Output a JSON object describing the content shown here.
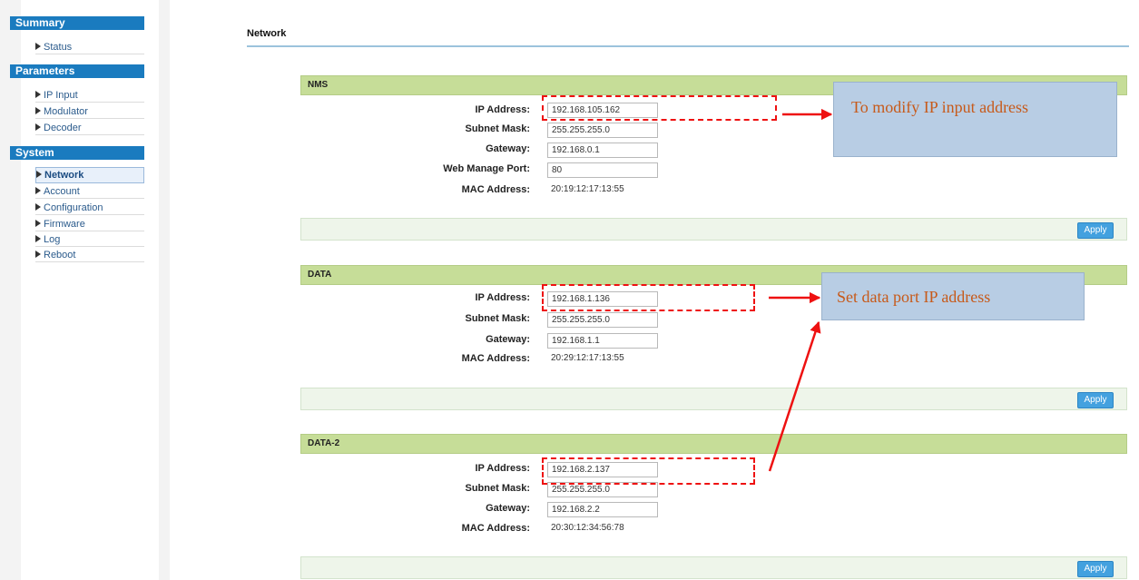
{
  "sidebar": {
    "sections": [
      {
        "title": "Summary",
        "items": [
          "Status"
        ]
      },
      {
        "title": "Parameters",
        "items": [
          "IP Input",
          "Modulator",
          "Decoder"
        ]
      },
      {
        "title": "System",
        "items": [
          "Network",
          "Account",
          "Configuration",
          "Firmware",
          "Log",
          "Reboot"
        ]
      }
    ],
    "active_item": "Network"
  },
  "page": {
    "title": "Network"
  },
  "panels": {
    "nms": {
      "title": "NMS",
      "ip_label": "IP Address:",
      "ip_value": "192.168.105.162",
      "subnet_label": "Subnet Mask:",
      "subnet_value": "255.255.255.0",
      "gateway_label": "Gateway:",
      "gateway_value": "192.168.0.1",
      "port_label": "Web Manage Port:",
      "port_value": "80",
      "mac_label": "MAC Address:",
      "mac_value": "20:19:12:17:13:55",
      "apply_label": "Apply"
    },
    "data": {
      "title": "DATA",
      "ip_label": "IP Address:",
      "ip_value": "192.168.1.136",
      "subnet_label": "Subnet Mask:",
      "subnet_value": "255.255.255.0",
      "gateway_label": "Gateway:",
      "gateway_value": "192.168.1.1",
      "mac_label": "MAC Address:",
      "mac_value": "20:29:12:17:13:55",
      "apply_label": "Apply"
    },
    "data2": {
      "title": "DATA-2",
      "ip_label": "IP Address:",
      "ip_value": "192.168.2.137",
      "subnet_label": "Subnet Mask:",
      "subnet_value": "255.255.255.0",
      "gateway_label": "Gateway:",
      "gateway_value": "192.168.2.2",
      "mac_label": "MAC Address:",
      "mac_value": "20:30:12:34:56:78",
      "apply_label": "Apply"
    }
  },
  "annotations": {
    "callout_nms": "To modify IP input address",
    "callout_data": "Set data port IP address",
    "highlight_color": "#ee1111",
    "callout_text_color": "#c75a1a"
  },
  "colors": {
    "sidebar_header": "#1a7bbf",
    "panel_header": "#c6dd98",
    "apply_button": "#43a1df"
  }
}
